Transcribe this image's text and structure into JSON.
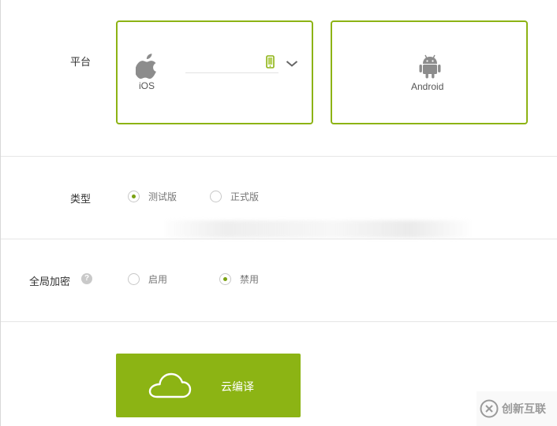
{
  "platform": {
    "label": "平台",
    "ios": {
      "name": "iOS",
      "selected": true
    },
    "android": {
      "name": "Android",
      "selected": false
    }
  },
  "type": {
    "label": "类型",
    "options": [
      {
        "label": "测试版",
        "checked": true
      },
      {
        "label": "正式版",
        "checked": false
      }
    ]
  },
  "encryption": {
    "label": "全局加密",
    "help": "?",
    "options": [
      {
        "label": "启用",
        "checked": false
      },
      {
        "label": "禁用",
        "checked": true
      }
    ]
  },
  "compile": {
    "label": "云编译"
  },
  "watermark": {
    "text": "创新互联"
  },
  "colors": {
    "accent": "#8db314",
    "radio_dot": "#7aa112"
  }
}
